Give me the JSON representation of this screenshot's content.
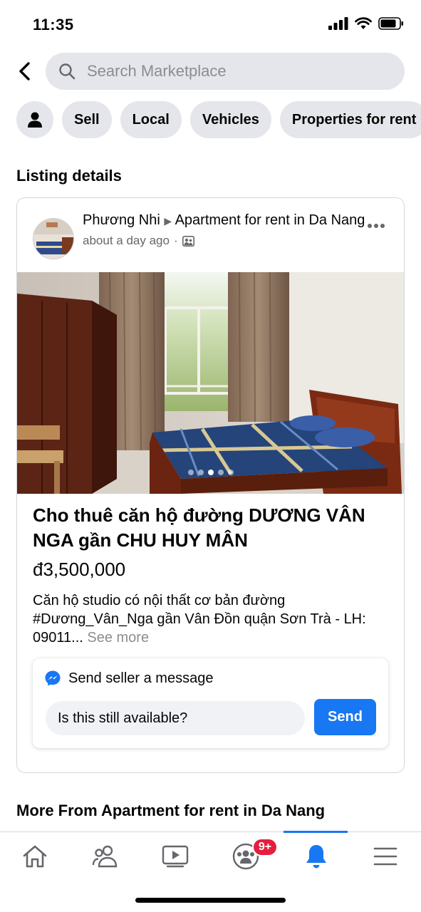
{
  "status_bar": {
    "time": "11:35"
  },
  "search": {
    "placeholder": "Search Marketplace"
  },
  "chips": [
    "Sell",
    "Local",
    "Vehicles",
    "Properties for rent"
  ],
  "section_listing": "Listing details",
  "post": {
    "author": "Phương Nhi",
    "group": "Apartment for rent in Da Nang",
    "time": "about a day ago",
    "photo_index": 3,
    "photo_count": 5
  },
  "listing": {
    "title": "Cho thuê căn hộ đường DƯƠNG VÂN NGA gần CHU HUY MÂN",
    "price": "đ3,500,000",
    "description": "Căn hộ studio có nội thất cơ bản đường #Dương_Vân_Nga gần Vân Đồn quận Sơn Trà - LH: 09011...",
    "see_more": "See more"
  },
  "message": {
    "header": "Send seller a message",
    "input_value": "Is this still available?",
    "send_label": "Send"
  },
  "section_more": "More From Apartment for rent in Da Nang",
  "bottom_nav": {
    "items": [
      "home-icon",
      "friends-icon",
      "watch-icon",
      "groups-icon",
      "notifications-icon",
      "menu-icon"
    ],
    "active": "notifications-icon",
    "groups_badge": "9+"
  },
  "colors": {
    "accent": "#1877f2",
    "badge": "#e41e3f",
    "chip_bg": "#e4e6eb"
  }
}
